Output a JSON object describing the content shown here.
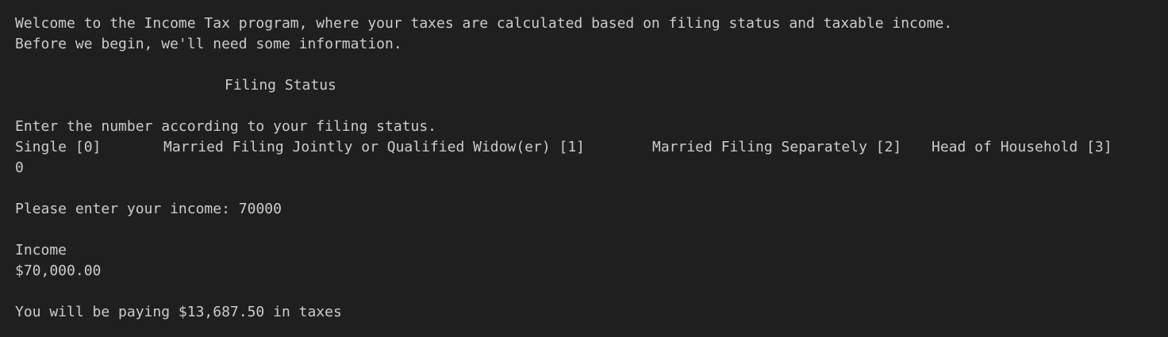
{
  "terminal": {
    "welcome_line": "Welcome to the Income Tax program, where your taxes are calculated based on filing status and taxable income.",
    "intro_line": "Before we begin, we'll need some information.",
    "section_title": "Filing Status",
    "prompt_filing_status": "Enter the number according to your filing status.",
    "filing_options": [
      "Single [0]",
      "Married Filing Jointly or Qualified Widow(er) [1]",
      "Married Filing Separately [2]",
      "Head of Household [3]"
    ],
    "filing_status_input": "0",
    "income_prompt": "Please enter your income: ",
    "income_input": "70000",
    "income_label": "Income",
    "income_value": "$70,000.00",
    "result_line": "You will be paying $13,687.50 in taxes"
  },
  "colors": {
    "background": "#1f1f1f",
    "text": "#cccccc"
  }
}
